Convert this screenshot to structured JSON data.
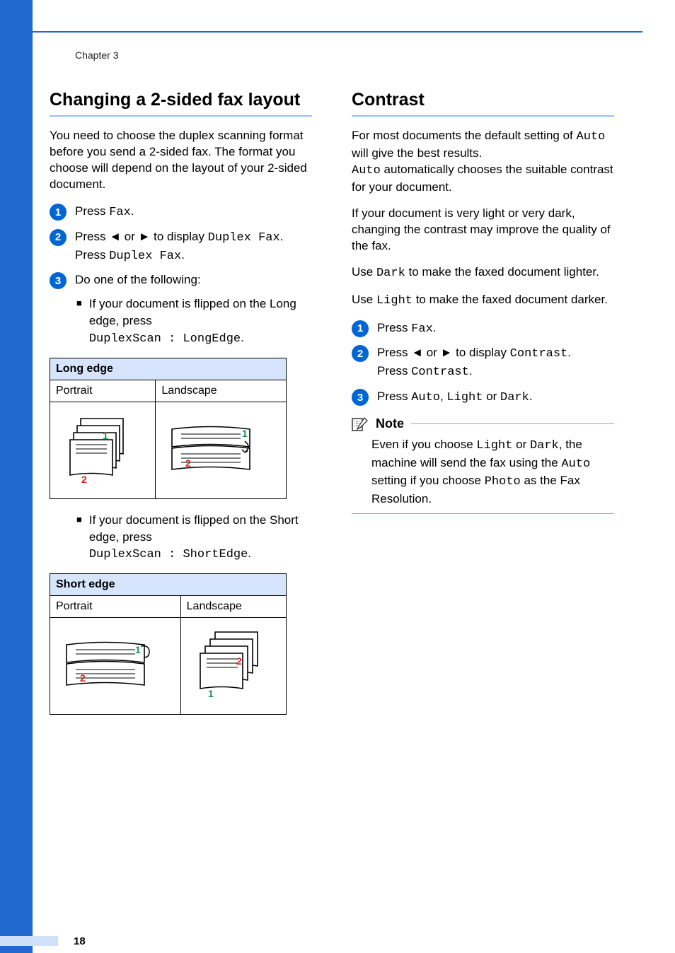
{
  "chapter": "Chapter 3",
  "page_number": "18",
  "left": {
    "heading": "Changing a 2-sided fax layout",
    "intro": "You need to choose the duplex scanning format before you send a 2-sided fax. The format you choose will depend on the layout of your 2-sided document.",
    "step1_a": "Press ",
    "step1_mono": "Fax",
    "step1_b": ".",
    "step2_a": "Press ",
    "step2_b": " or ",
    "step2_c": " to display ",
    "step2_mono1": "Duplex Fax",
    "step2_d": ".",
    "step2_line2a": "Press ",
    "step2_line2_mono": "Duplex Fax",
    "step2_line2b": ".",
    "step3": "Do one of the following:",
    "bullet1_a": "If your document is flipped on the Long edge, press",
    "bullet1_mono": "DuplexScan : LongEdge",
    "bullet1_b": ".",
    "table1_header": "Long edge",
    "col_portrait": "Portrait",
    "col_landscape": "Landscape",
    "bullet2_a": "If your document is flipped on the Short edge, press",
    "bullet2_mono": "DuplexScan : ShortEdge",
    "bullet2_b": ".",
    "table2_header": "Short edge"
  },
  "right": {
    "heading": "Contrast",
    "p1_a": "For most documents the default setting of ",
    "p1_mono1": "Auto",
    "p1_b": " will give the best results.",
    "p1_line2_mono": "Auto",
    "p1_line2_b": " automatically chooses the suitable contrast for your document.",
    "p2": "If your document is very light or very dark, changing the contrast may improve the quality of the fax.",
    "p3_a": "Use ",
    "p3_mono": "Dark",
    "p3_b": " to make the faxed document lighter.",
    "p4_a": "Use ",
    "p4_mono": "Light",
    "p4_b": " to make the faxed document darker.",
    "step1_a": "Press ",
    "step1_mono": "Fax",
    "step1_b": ".",
    "step2_a": "Press ",
    "step2_b": " or ",
    "step2_c": " to display ",
    "step2_mono1": "Contrast",
    "step2_d": ".",
    "step2_line2a": "Press ",
    "step2_line2_mono": "Contrast",
    "step2_line2b": ".",
    "step3_a": "Press ",
    "step3_mono1": "Auto",
    "step3_b": ", ",
    "step3_mono2": "Light",
    "step3_c": " or ",
    "step3_mono3": "Dark",
    "step3_d": ".",
    "note_label": "Note",
    "note_a": "Even if you choose ",
    "note_mono1": "Light",
    "note_b": " or ",
    "note_mono2": "Dark",
    "note_c": ", the machine will send the fax using the ",
    "note_mono3": "Auto",
    "note_d": " setting if you choose ",
    "note_mono4": "Photo",
    "note_e": " as the Fax Resolution."
  },
  "arrows": {
    "left": "◄",
    "right": "►"
  },
  "fig_labels": {
    "one": "1",
    "two": "2"
  }
}
